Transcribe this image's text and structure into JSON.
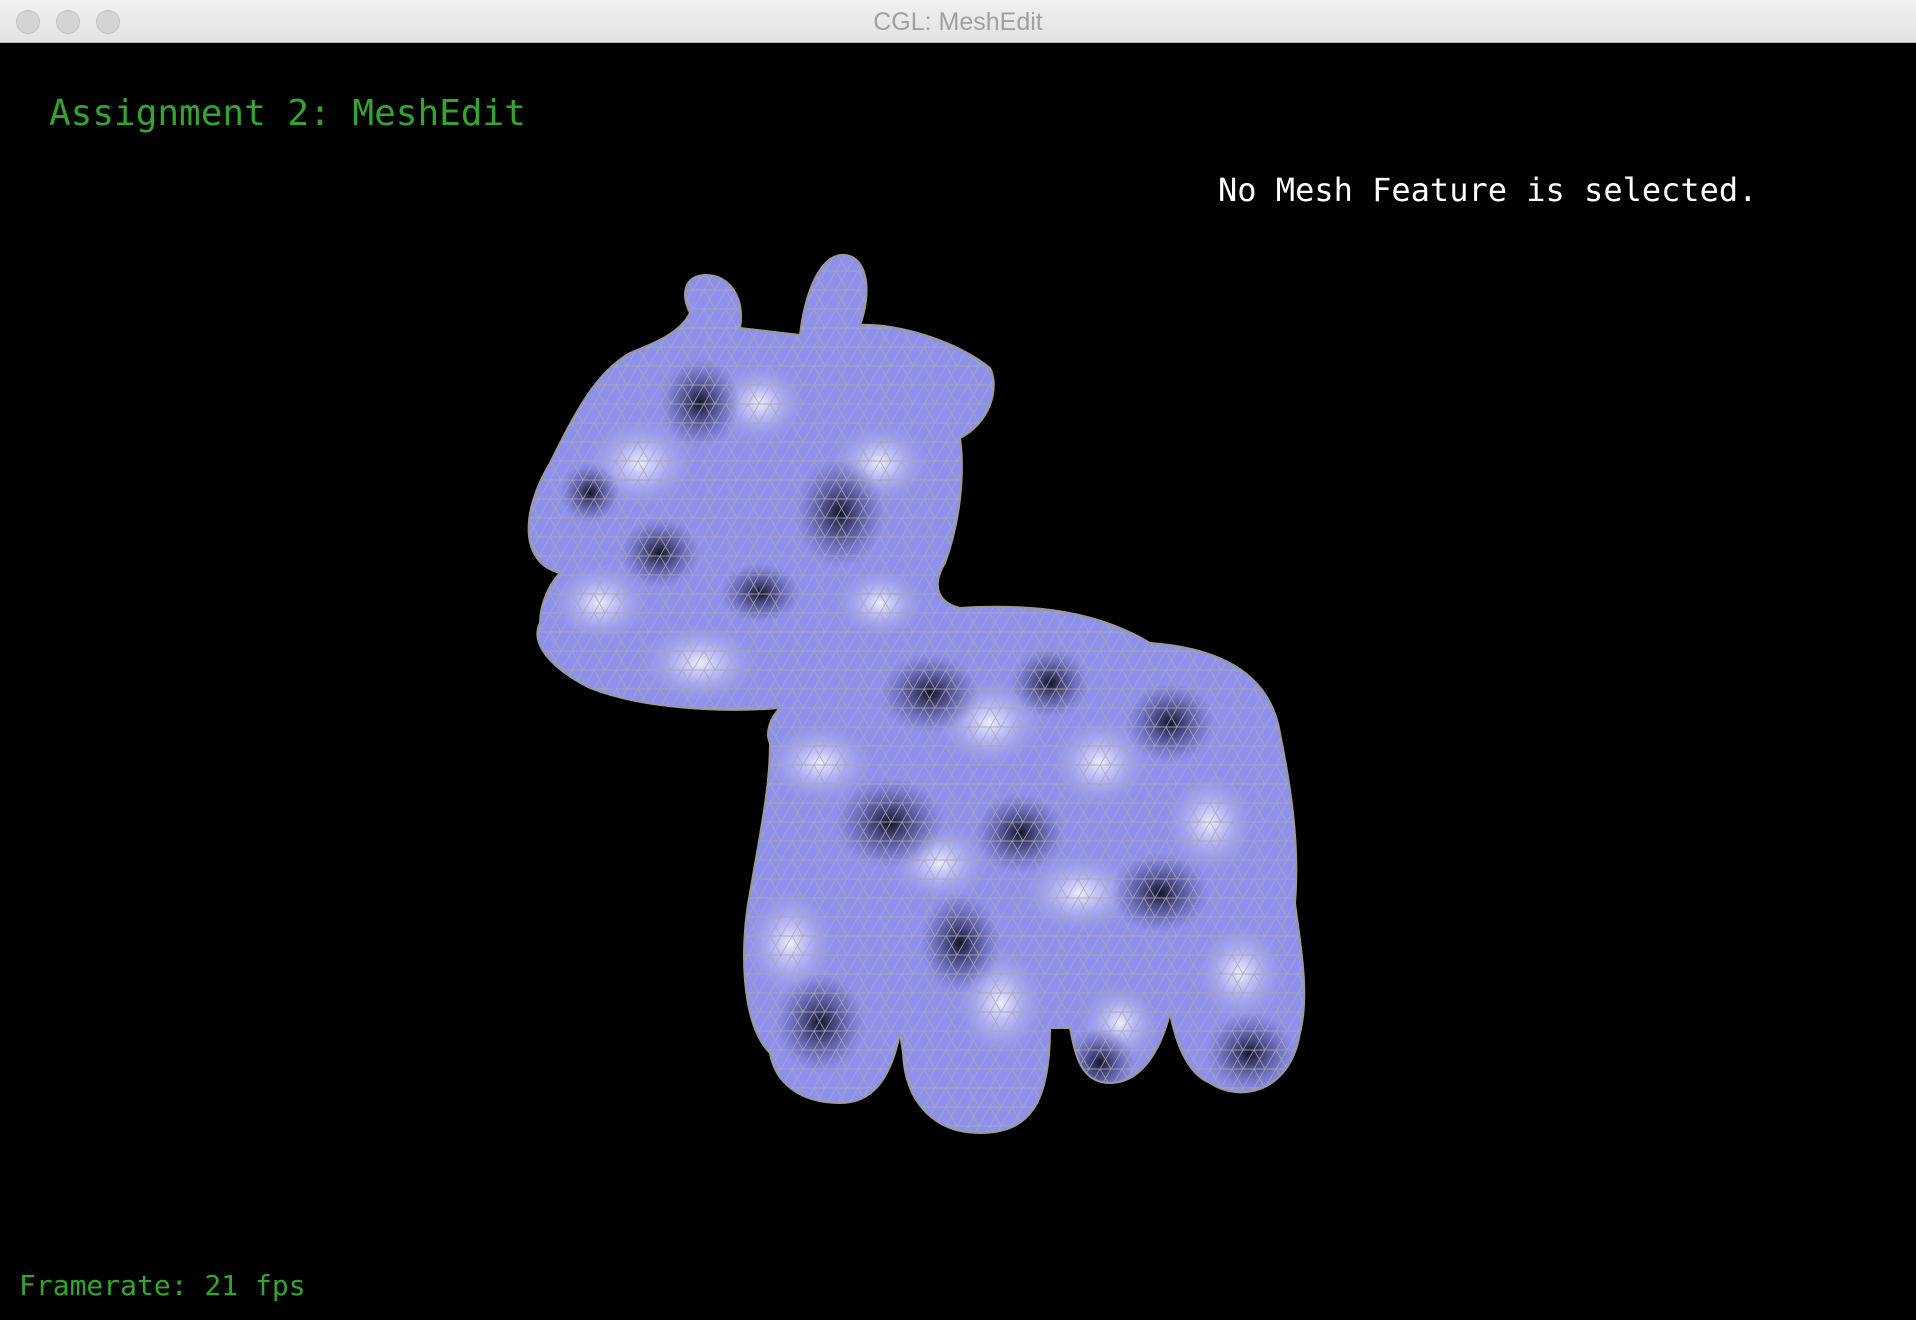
{
  "window": {
    "title": "CGL: MeshEdit"
  },
  "hud": {
    "assignment_title": "Assignment 2: MeshEdit",
    "selection_status": "No Mesh Feature is selected.",
    "framerate": "Framerate: 21 fps"
  },
  "colors": {
    "background": "#000000",
    "hud_green": "#33a52e",
    "status_white": "#ffffff",
    "mesh_light": "#d8d9ff",
    "mesh_mid": "#8a8cf0",
    "mesh_dark": "#17172a",
    "wireframe": "#9a9a9a"
  },
  "viewport": {
    "model": "cow mesh with wireframe overlay"
  }
}
